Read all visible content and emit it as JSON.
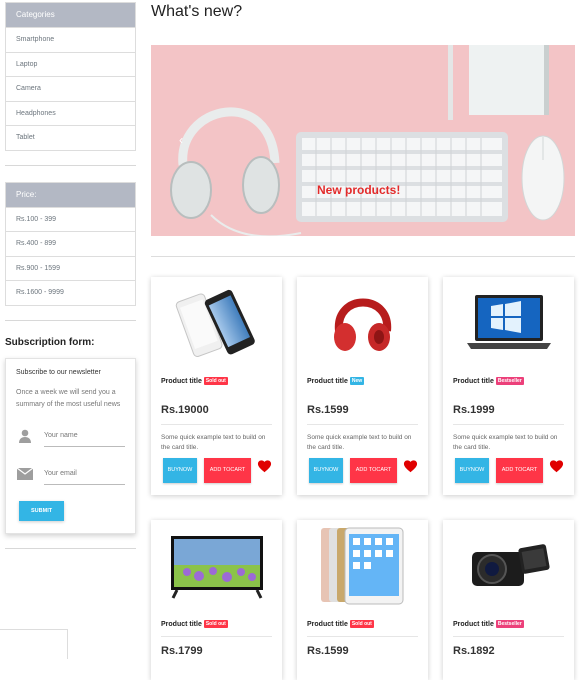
{
  "sidebar": {
    "categories_header": "Categories",
    "categories": [
      "Smartphone",
      "Laptop",
      "Camera",
      "Headphones",
      "Tablet"
    ],
    "price_header": "Price:",
    "prices": [
      "Rs.100 - 399",
      "Rs.400 - 899",
      "Rs.900 - 1599",
      "Rs.1600 - 9999"
    ]
  },
  "subscription": {
    "title": "Subscription form:",
    "card_title": "Subscribe to our newsletter",
    "description": "Once a week we will send you a summary of the most useful news",
    "name_placeholder": "Your name",
    "email_placeholder": "Your email",
    "submit_label": "SUBMIT"
  },
  "main": {
    "title": "What's new?",
    "carousel_caption": "New products!",
    "carousel_prev": "‹"
  },
  "products": [
    {
      "image": "smartphone",
      "title": "Product title",
      "badge": "Sold out",
      "badge_color": "#ff3547",
      "price": "Rs.19000",
      "text": "Some quick example text to build on the card title."
    },
    {
      "image": "headphones",
      "title": "Product title",
      "badge": "New",
      "badge_color": "#33b5e5",
      "price": "Rs.1599",
      "text": "Some quick example text to build on the card title."
    },
    {
      "image": "laptop",
      "title": "Product title",
      "badge": "Bestseller",
      "badge_color": "#ec407a",
      "price": "Rs.1999",
      "text": "Some quick example text to build on the card title."
    },
    {
      "image": "tv",
      "title": "Product title",
      "badge": "Sold out",
      "badge_color": "#ff3547",
      "price": "Rs.1799",
      "text": ""
    },
    {
      "image": "tablet",
      "title": "Product title",
      "badge": "Sold out",
      "badge_color": "#ff3547",
      "price": "Rs.1599",
      "text": ""
    },
    {
      "image": "camera",
      "title": "Product title",
      "badge": "Bestseller",
      "badge_color": "#ec407a",
      "price": "Rs.1892",
      "text": ""
    }
  ],
  "buttons": {
    "buy": "BUY NOW",
    "cart": "ADD TO CART"
  },
  "colors": {
    "primary": "#33b5e5",
    "danger": "#ff3547",
    "pink": "#ec407a",
    "heart": "#e00000"
  }
}
